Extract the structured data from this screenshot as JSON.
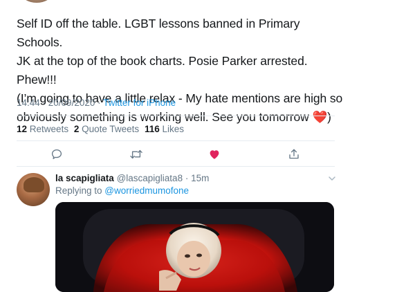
{
  "tweet": {
    "lines": [
      "Self ID off the table. LGBT lessons banned in Primary Schools.",
      "JK at the top of the book charts.  Posie Parker arrested.  Phew!!!",
      "(I’m going to have a little relax - My hate mentions are high so",
      "obviously something is working well. See you tomorrow "
    ],
    "emoji": "❤️",
    "closing": ")",
    "time": "14:44 · 20/09/2020",
    "separator": " · ",
    "source": "Twitter for iPhone"
  },
  "stats": {
    "retweets_count": "12",
    "retweets_label": "Retweets",
    "quotes_count": "2",
    "quotes_label": "Quote Tweets",
    "likes_count": "116",
    "likes_label": "Likes"
  },
  "actions": {
    "icons": [
      "reply-icon",
      "retweet-icon",
      "like-icon",
      "share-icon"
    ],
    "like_color": "#e0245e"
  },
  "reply": {
    "name": "la scapigliata",
    "handle": "@lascapigliata8",
    "dot": " · ",
    "time": "15m",
    "replying_to_label": "Replying to ",
    "replying_to_handle": "@worriedmumofone"
  },
  "colors": {
    "text": "#14171a",
    "secondary": "#657786",
    "link": "#1b95e0",
    "divider": "#e6ecf0"
  }
}
